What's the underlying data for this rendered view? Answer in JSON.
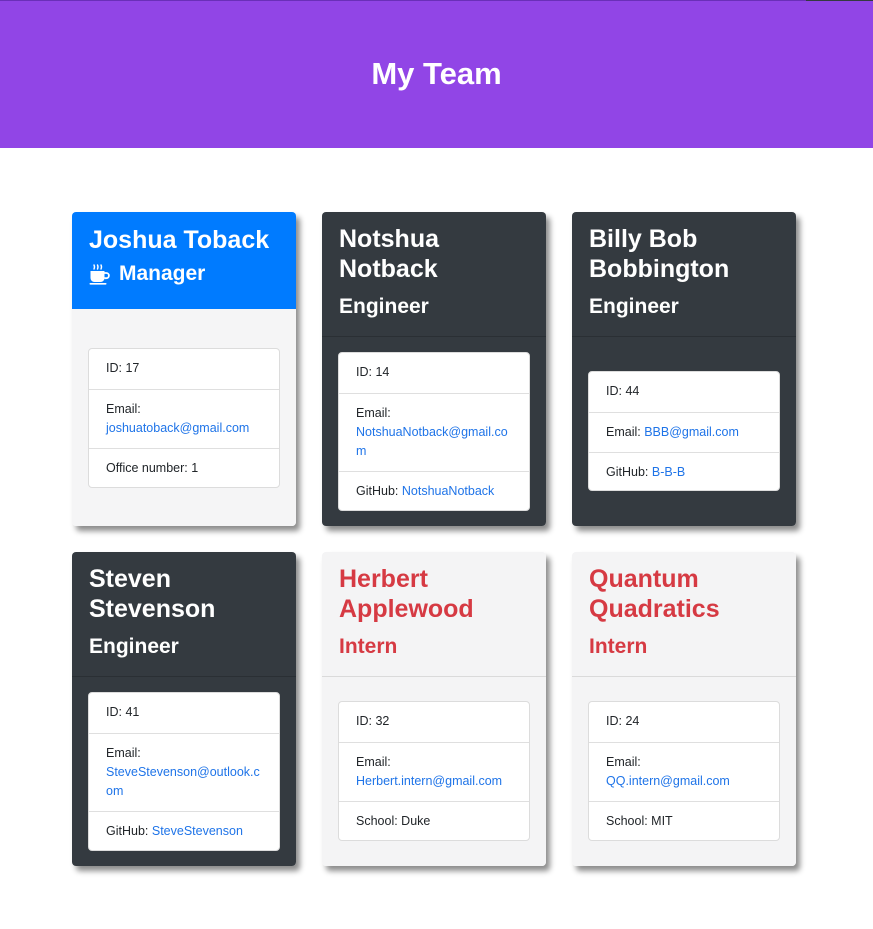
{
  "header": {
    "title": "My Team"
  },
  "team": [
    {
      "name": "Joshua Toback",
      "role": "Manager",
      "role_icon": "coffee-mug-icon",
      "id_text": "ID: 17",
      "email_label": "Email:",
      "email": "joshuatoback@gmail.com",
      "extra_label": "Office number: 1",
      "extra_value": ""
    },
    {
      "name_line1": "Notshua",
      "name_line2": "Notback",
      "role": "Engineer",
      "id_text": "ID: 14",
      "email_label": "Email:",
      "email": "NotshuaNotback@gmail.com",
      "extra_label": "GitHub:",
      "extra_value": "NotshuaNotback"
    },
    {
      "name_line1": "Billy Bob",
      "name_line2": "Bobbington",
      "role": "Engineer",
      "id_text": "ID: 44",
      "email_label": "Email:",
      "email": "BBB@gmail.com",
      "extra_label": "GitHub:",
      "extra_value": "B-B-B"
    },
    {
      "name_line1": "Steven",
      "name_line2": "Stevenson",
      "role": "Engineer",
      "id_text": "ID: 41",
      "email_label": "Email:",
      "email": "SteveStevenson@outlook.com",
      "extra_label": "GitHub:",
      "extra_value": "SteveStevenson"
    },
    {
      "name_line1": "Herbert",
      "name_line2": "Applewood",
      "role": "Intern",
      "id_text": "ID: 32",
      "email_label": "Email:",
      "email": "Herbert.intern@gmail.com",
      "extra_label": "School: Duke",
      "extra_value": ""
    },
    {
      "name_line1": "Quantum",
      "name_line2": "Quadratics",
      "role": "Intern",
      "id_text": "ID: 24",
      "email_label": "Email:",
      "email": "QQ.intern@gmail.com",
      "extra_label": "School: MIT",
      "extra_value": ""
    }
  ],
  "colors": {
    "header_bg": "#9145e6",
    "manager_bg": "#007bff",
    "engineer_bg": "#343a40",
    "intern_bg": "#f4f4f5",
    "intern_text": "#d63a43",
    "link": "#1f74e8"
  }
}
